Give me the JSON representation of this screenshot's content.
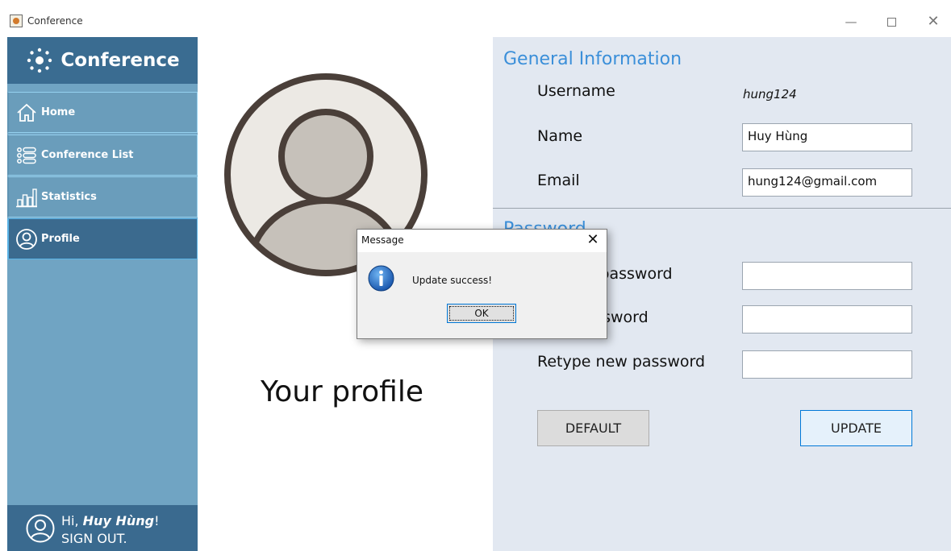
{
  "window": {
    "title": "Conference",
    "minimize_glyph": "—",
    "close_glyph": "✕"
  },
  "sidebar": {
    "brand": "Conference",
    "items": [
      {
        "label": "Home",
        "icon": "home-icon"
      },
      {
        "label": "Conference List",
        "icon": "list-icon"
      },
      {
        "label": "Statistics",
        "icon": "bar-chart-icon"
      },
      {
        "label": "Profile",
        "icon": "user-icon",
        "active": true
      }
    ],
    "user": {
      "greeting_prefix": "Hi, ",
      "name": "Huy Hùng",
      "greeting_suffix": "!",
      "signout": "SIGN OUT."
    }
  },
  "profile": {
    "caption": "Your profile"
  },
  "general": {
    "title": "General Information",
    "username_label": "Username",
    "username_value": "hung124",
    "name_label": "Name",
    "name_value": "Huy Hùng",
    "email_label": "Email",
    "email_value": "hung124@gmail.com"
  },
  "password": {
    "title": "Password",
    "current_label": "Current password",
    "new_label": "New password",
    "retype_label": "Retype new password"
  },
  "buttons": {
    "default": "DEFAULT",
    "update": "UPDATE"
  },
  "dialog": {
    "title": "Message",
    "close_glyph": "✕",
    "message": "Update success!",
    "ok": "OK"
  },
  "colors": {
    "sidebar_bg": "#70a4c3",
    "sidebar_dark": "#3a6c91",
    "panel_bg": "#e2e8f1",
    "section_title": "#3b8fd9",
    "avatar_ring": "#4a3f39",
    "avatar_fill": "#c6c1ba"
  }
}
